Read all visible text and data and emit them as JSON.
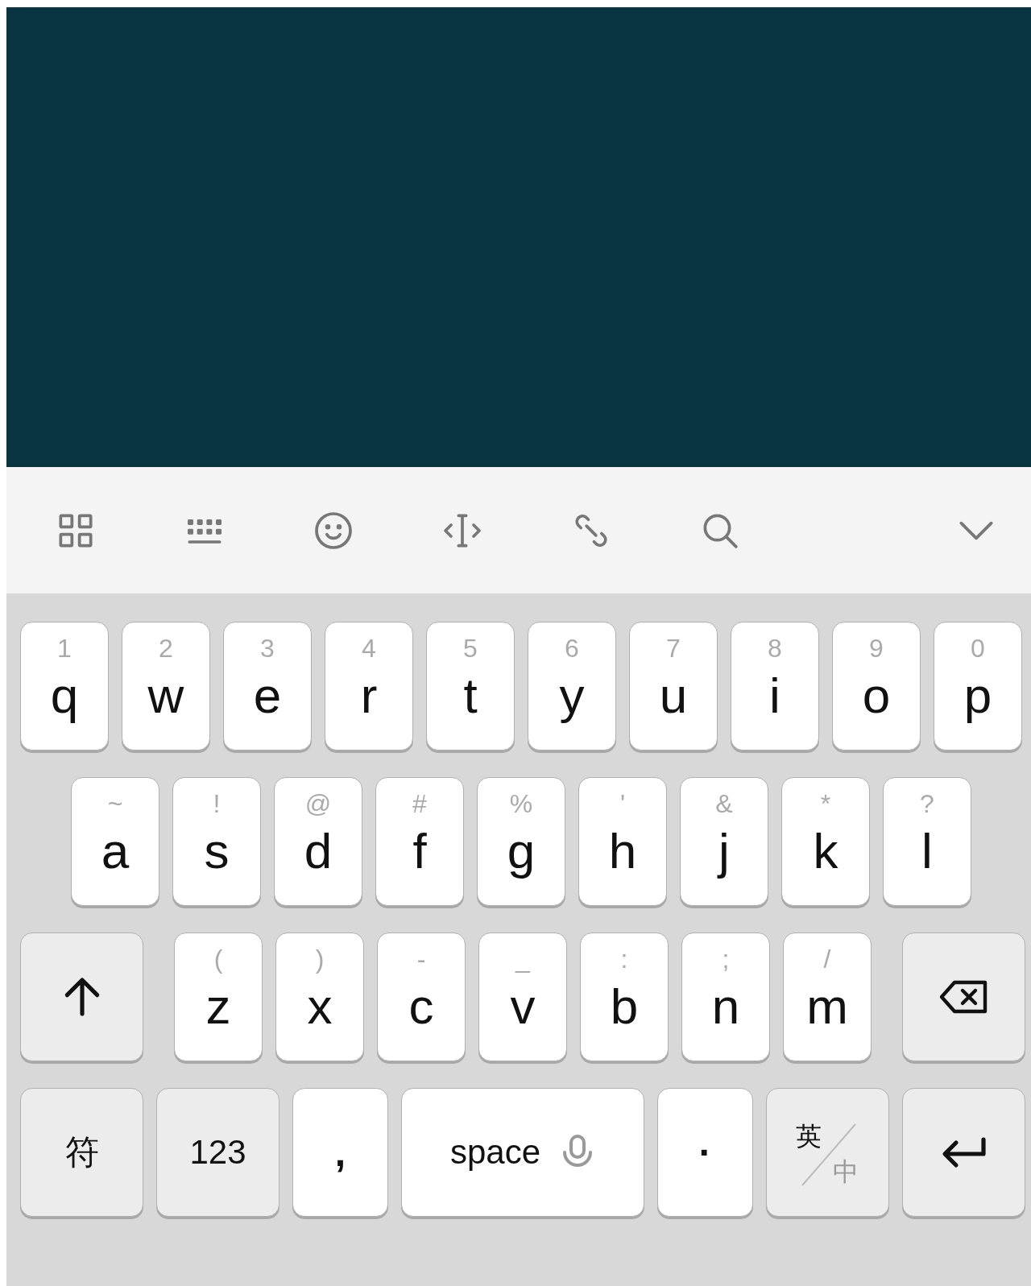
{
  "keyboard": {
    "rows": [
      {
        "keys": [
          {
            "kind": "letter",
            "label": "q",
            "hint": "1"
          },
          {
            "kind": "letter",
            "label": "w",
            "hint": "2"
          },
          {
            "kind": "letter",
            "label": "e",
            "hint": "3"
          },
          {
            "kind": "letter",
            "label": "r",
            "hint": "4"
          },
          {
            "kind": "letter",
            "label": "t",
            "hint": "5"
          },
          {
            "kind": "letter",
            "label": "y",
            "hint": "6"
          },
          {
            "kind": "letter",
            "label": "u",
            "hint": "7"
          },
          {
            "kind": "letter",
            "label": "i",
            "hint": "8"
          },
          {
            "kind": "letter",
            "label": "o",
            "hint": "9"
          },
          {
            "kind": "letter",
            "label": "p",
            "hint": "0"
          }
        ]
      },
      {
        "keys": [
          {
            "kind": "letter",
            "label": "a",
            "hint": "~"
          },
          {
            "kind": "letter",
            "label": "s",
            "hint": "!"
          },
          {
            "kind": "letter",
            "label": "d",
            "hint": "@"
          },
          {
            "kind": "letter",
            "label": "f",
            "hint": "#"
          },
          {
            "kind": "letter",
            "label": "g",
            "hint": "%"
          },
          {
            "kind": "letter",
            "label": "h",
            "hint": "'"
          },
          {
            "kind": "letter",
            "label": "j",
            "hint": "&"
          },
          {
            "kind": "letter",
            "label": "k",
            "hint": "*"
          },
          {
            "kind": "letter",
            "label": "l",
            "hint": "?"
          }
        ]
      },
      {
        "keys": [
          {
            "kind": "shift"
          },
          {
            "kind": "letter",
            "label": "z",
            "hint": "("
          },
          {
            "kind": "letter",
            "label": "x",
            "hint": ")"
          },
          {
            "kind": "letter",
            "label": "c",
            "hint": "-"
          },
          {
            "kind": "letter",
            "label": "v",
            "hint": "_"
          },
          {
            "kind": "letter",
            "label": "b",
            "hint": ":"
          },
          {
            "kind": "letter",
            "label": "n",
            "hint": ";"
          },
          {
            "kind": "letter",
            "label": "m",
            "hint": "/"
          },
          {
            "kind": "backspace"
          }
        ]
      },
      {
        "keys": [
          {
            "kind": "function",
            "label": "符"
          },
          {
            "kind": "function",
            "label": "123"
          },
          {
            "kind": "punct",
            "label": ","
          },
          {
            "kind": "space",
            "label": "space"
          },
          {
            "kind": "punct",
            "label": "·"
          },
          {
            "kind": "lang",
            "primary": "英",
            "secondary": "中"
          },
          {
            "kind": "enter"
          }
        ]
      }
    ]
  }
}
